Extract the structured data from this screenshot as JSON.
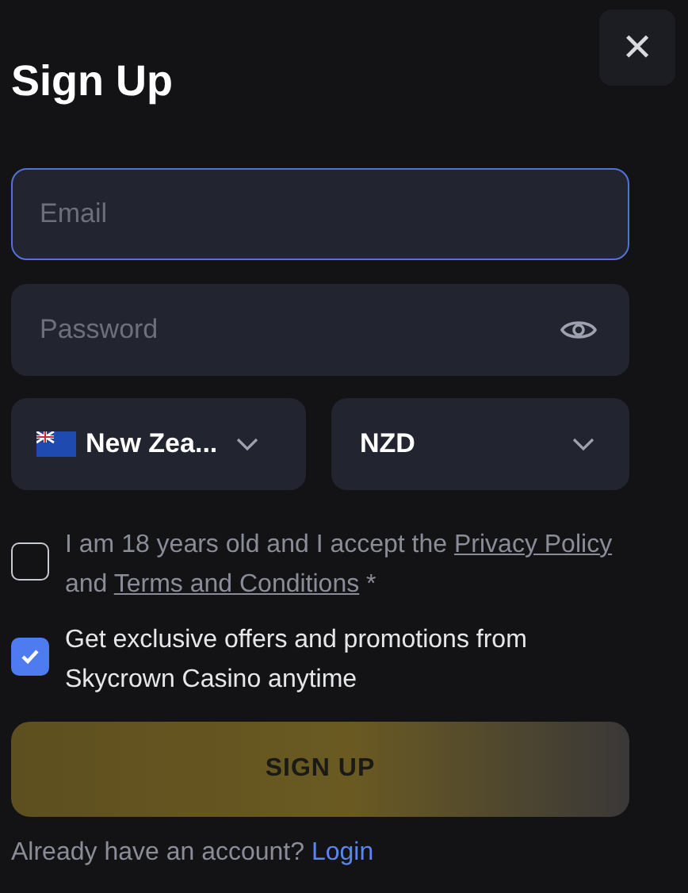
{
  "title": "Sign Up",
  "close": "✕",
  "email": {
    "placeholder": "Email",
    "focused": true
  },
  "password": {
    "placeholder": "Password"
  },
  "country": {
    "value": "New Zea..."
  },
  "currency": {
    "value": "NZD"
  },
  "consents": [
    {
      "checked": false,
      "parts": [
        {
          "text": "I am 18 years old and I accept the "
        },
        {
          "text": "Privacy Policy",
          "link": true
        },
        {
          "text": " and "
        },
        {
          "text": "Terms and Conditions",
          "link": true
        },
        {
          "text": " *"
        }
      ]
    },
    {
      "checked": true,
      "parts": [
        {
          "text": "Get exclusive offers and promotions from Skycrown Casino anytime",
          "strong": true
        }
      ]
    }
  ],
  "submit": {
    "label": "SIGN UP",
    "disabled": true
  },
  "footer": {
    "text": "Already have an account?",
    "link": "Login"
  }
}
